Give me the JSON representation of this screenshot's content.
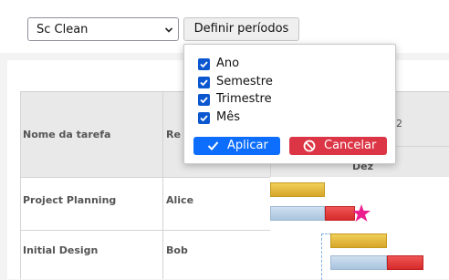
{
  "toolbar": {
    "theme_select": {
      "value": "Sc Clean"
    },
    "periods_button": "Definir períodos"
  },
  "period_popup": {
    "options": [
      {
        "label": "Ano",
        "checked": true
      },
      {
        "label": "Semestre",
        "checked": true
      },
      {
        "label": "Trimestre",
        "checked": true
      },
      {
        "label": "Mês",
        "checked": true
      }
    ],
    "apply_label": "Aplicar",
    "cancel_label": "Cancelar",
    "colors": {
      "apply": "#0d6efd",
      "cancel": "#dc3545",
      "checkbox": "#0b57d0"
    }
  },
  "gantt": {
    "headers": {
      "task": "Nome da tarefa",
      "resource_partial": "Re",
      "year_partial": "2",
      "month_partial": "Dez"
    },
    "rows": [
      {
        "task": "Project Planning",
        "resource": "Alice"
      },
      {
        "task": "Initial Design",
        "resource": "Bob"
      }
    ],
    "colors": {
      "planned": "#e0b53a",
      "actual": "#b9d0e8",
      "late": "#e23a3a",
      "milestone": "#ec1f8f"
    }
  }
}
